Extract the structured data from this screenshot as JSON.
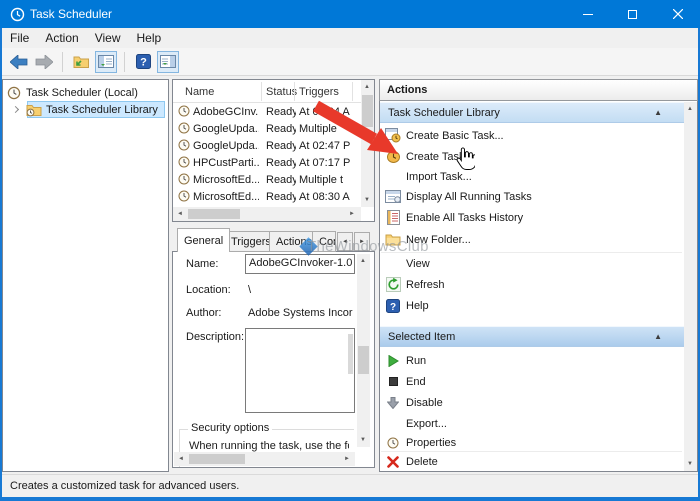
{
  "window": {
    "title": "Task Scheduler"
  },
  "menu": {
    "items": [
      "File",
      "Action",
      "View",
      "Help"
    ]
  },
  "tree": {
    "root": "Task Scheduler (Local)",
    "library": "Task Scheduler Library"
  },
  "task_list": {
    "columns": {
      "name": "Name",
      "status": "Status",
      "triggers": "Triggers"
    },
    "rows": [
      {
        "name": "AdobeGCInv...",
        "status": "Ready",
        "triggers": "At 05:34 A"
      },
      {
        "name": "GoogleUpda...",
        "status": "Ready",
        "triggers": "Multiple"
      },
      {
        "name": "GoogleUpda...",
        "status": "Ready",
        "triggers": "At 02:47 P"
      },
      {
        "name": "HPCustParti...",
        "status": "Ready",
        "triggers": "At 07:17 P"
      },
      {
        "name": "MicrosoftEd...",
        "status": "Ready",
        "triggers": "Multiple t"
      },
      {
        "name": "MicrosoftEd...",
        "status": "Ready",
        "triggers": "At 08:30 A"
      }
    ]
  },
  "detail": {
    "tabs": {
      "general": "General",
      "triggers": "Triggers",
      "actions": "Actions",
      "conditions": "Con"
    },
    "name_label": "Name:",
    "name_value": "AdobeGCInvoker-1.0",
    "location_label": "Location:",
    "location_value": "\\",
    "author_label": "Author:",
    "author_value": "Adobe Systems Incor",
    "description_label": "Description:",
    "security_group": "Security options",
    "security_text": "When running the task, use the fo"
  },
  "actions_pane": {
    "header": "Actions",
    "section1": {
      "title": "Task Scheduler Library",
      "items": [
        "Create Basic Task...",
        "Create Task...",
        "Import Task...",
        "Display All Running Tasks",
        "Enable All Tasks History",
        "New Folder...",
        "View",
        "Refresh",
        "Help"
      ]
    },
    "section2": {
      "title": "Selected Item",
      "items": [
        "Run",
        "End",
        "Disable",
        "Export...",
        "Properties",
        "Delete"
      ]
    }
  },
  "status_bar": {
    "text": "Creates a customized task for advanced users."
  },
  "watermark": {
    "text": "TheWindowsClub"
  },
  "icons": {
    "collapse": "▲",
    "submenu": "►",
    "scroll_up": "▲",
    "scroll_down": "▼",
    "scroll_left": "◄",
    "scroll_right": "►",
    "tab_prev": "◄",
    "tab_next": "►"
  },
  "colors": {
    "accent": "#0078d7",
    "selection": "#cce8ff",
    "annotation_arrow": "#e8392a"
  }
}
